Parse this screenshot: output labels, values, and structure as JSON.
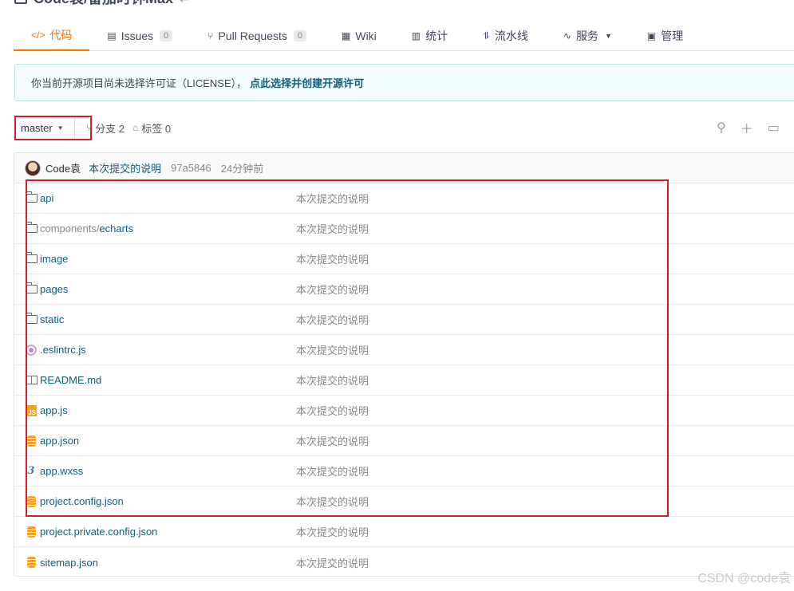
{
  "repo": {
    "title": "Code袁/番茄时钟Max"
  },
  "tabs": [
    {
      "label": "代码",
      "icon": "code-icon",
      "active": true
    },
    {
      "label": "Issues",
      "icon": "issues-icon",
      "badge": "0"
    },
    {
      "label": "Pull Requests",
      "icon": "pull-request-icon",
      "badge": "0"
    },
    {
      "label": "Wiki",
      "icon": "wiki-icon"
    },
    {
      "label": "统计",
      "icon": "stats-icon"
    },
    {
      "label": "流水线",
      "icon": "pipeline-icon"
    },
    {
      "label": "服务",
      "icon": "service-icon",
      "dropdown": true
    },
    {
      "label": "管理",
      "icon": "manage-icon"
    }
  ],
  "notice": {
    "text": "你当前开源项目尚未选择许可证（LICENSE），",
    "link": "点此选择并创建开源许可"
  },
  "branch": {
    "current": "master",
    "branches_label": "分支 2",
    "tags_label": "标签 0"
  },
  "latest_commit": {
    "author": "Code袁",
    "message": "本次提交的说明",
    "sha": "97a5846",
    "time": "24分钟前"
  },
  "files": [
    {
      "type": "folder",
      "name": "api",
      "message": "本次提交的说明"
    },
    {
      "type": "folder",
      "name_prefix": "components/",
      "name": "echarts",
      "message": "本次提交的说明"
    },
    {
      "type": "folder",
      "name": "image",
      "message": "本次提交的说明"
    },
    {
      "type": "folder",
      "name": "pages",
      "message": "本次提交的说明"
    },
    {
      "type": "folder",
      "name": "static",
      "message": "本次提交的说明"
    },
    {
      "type": "eslint",
      "name": ".eslintrc.js",
      "message": "本次提交的说明"
    },
    {
      "type": "readme",
      "name": "README.md",
      "message": "本次提交的说明"
    },
    {
      "type": "js",
      "name": "app.js",
      "message": "本次提交的说明"
    },
    {
      "type": "json",
      "name": "app.json",
      "message": "本次提交的说明"
    },
    {
      "type": "css",
      "name": "app.wxss",
      "message": "本次提交的说明"
    },
    {
      "type": "json",
      "name": "project.config.json",
      "message": "本次提交的说明"
    },
    {
      "type": "json",
      "name": "project.private.config.json",
      "message": "本次提交的说明"
    },
    {
      "type": "json",
      "name": "sitemap.json",
      "message": "本次提交的说明"
    }
  ],
  "watermark": "CSDN @code袁",
  "colors": {
    "accent": "#fe7300",
    "link": "#0e5f7a",
    "annotation_red": "#d71d27"
  }
}
